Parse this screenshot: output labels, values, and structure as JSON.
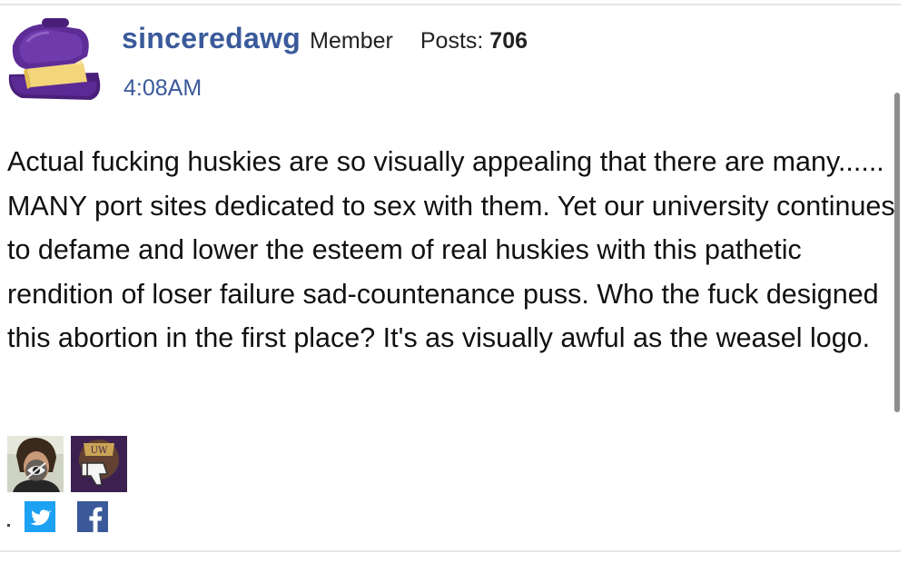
{
  "post": {
    "author": {
      "username": "sinceredawg",
      "role": "Member",
      "posts_label": "Posts:",
      "posts_count": "706",
      "avatar_icon": "butter-dish-icon"
    },
    "timestamp": "4:08AM",
    "body": "Actual fucking huskies are so visually appealing that there are many...... MANY port sites dedicated to sex with them. Yet our university continues to defame and lower the esteem of real huskies with this pathetic rendition of loser failure sad-countenance puss. Who the fuck designed this abortion in the first place? It's as visually awful as the weasel logo.",
    "reactions": [
      {
        "name": "insightful-reaction",
        "icon": "eye-icon"
      },
      {
        "name": "disagree-reaction",
        "icon": "thumbs-down-icon"
      }
    ],
    "share": [
      {
        "name": "twitter",
        "icon": "twitter-bird-icon"
      },
      {
        "name": "facebook",
        "icon": "facebook-f-icon"
      }
    ]
  },
  "colors": {
    "link": "#3a5a9a",
    "text": "#111111",
    "twitter": "#1da1f2",
    "facebook": "#3b5998"
  }
}
